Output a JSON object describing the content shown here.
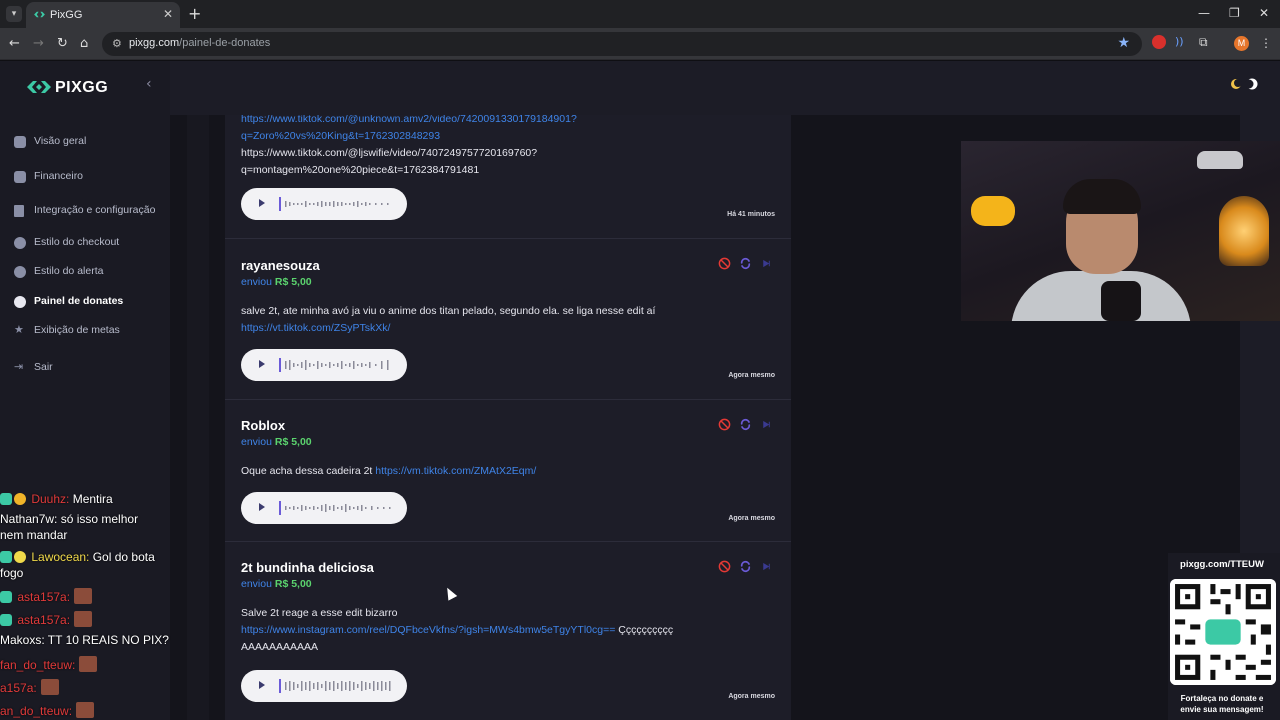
{
  "browser": {
    "tab_title": "PixGG",
    "url_host": "pixgg.com",
    "url_path": "/painel-de-donates",
    "profile_initial": "M"
  },
  "app": {
    "logo": "PIXGG",
    "sidebar": {
      "items": [
        {
          "label": "Visão geral",
          "icon": "home-icon"
        },
        {
          "label": "Financeiro",
          "icon": "wallet-icon"
        },
        {
          "label": "Integração e configuração",
          "icon": "settings-icon"
        },
        {
          "label": "Estilo do checkout",
          "icon": "palette-icon"
        },
        {
          "label": "Estilo do alerta",
          "icon": "bell-icon"
        },
        {
          "label": "Painel de donates",
          "icon": "donate-icon",
          "active": true
        },
        {
          "label": "Exibição de metas",
          "icon": "star-icon"
        },
        {
          "label": "Sair",
          "icon": "logout-icon"
        }
      ]
    },
    "donations": [
      {
        "msg_lines": [
          "https://www.tiktok.com/@unknown.amv2/video/7420091330179184901?",
          "q=Zoro%20vs%20King&t=1762302848293"
        ],
        "msg_lines2": [
          "https://www.tiktok.com/@ljswifie/video/7407249757720169760?",
          "q=montagem%20one%20piece&t=1762384791481"
        ],
        "time": "Há 41 minutos"
      },
      {
        "name": "rayanesouza",
        "sent_label": "enviou",
        "amount": "R$ 5,00",
        "text": "salve 2t, ate minha avó ja viu o anime dos titan pelado, segundo ela. se liga nesse edit aí",
        "link": "https://vt.tiktok.com/ZSyPTskXk/",
        "time": "Agora mesmo"
      },
      {
        "name": "Roblox",
        "sent_label": "enviou",
        "amount": "R$ 5,00",
        "text": "Oque acha dessa cadeira 2t ",
        "link": "https://vm.tiktok.com/ZMAtX2Eqm/",
        "time": "Agora mesmo"
      },
      {
        "name": "2t bundinha deliciosa",
        "sent_label": "enviou",
        "amount": "R$ 5,00",
        "text": "Salve 2t reage a esse edit bizarro",
        "link": "https://www.instagram.com/reel/DQFbceVkfns/?igsh=MWs4bmw5eTgyYTl0cg==",
        "text_after": " Çççççççççç",
        "text_line3": "AAAAAAAAAAA",
        "time": "Agora mesmo"
      }
    ]
  },
  "chat": [
    {
      "user": "Duuhz:",
      "color": "#e03a3a",
      "text": " Mentira"
    },
    {
      "user": "Nathan7w:",
      "color": "#ffffff",
      "text": " só isso melhor"
    },
    {
      "user": "",
      "color": "#ffffff",
      "text": "nem mandar"
    },
    {
      "user": "Lawocean:",
      "color": "#f0d94a",
      "text": " Gol do bota"
    },
    {
      "user": "",
      "color": "#ffffff",
      "text": "fogo"
    },
    {
      "user": "asta157a:",
      "color": "#e03a3a",
      "text": ""
    },
    {
      "user": "asta157a:",
      "color": "#e03a3a",
      "text": ""
    },
    {
      "user": "Makoxs:",
      "color": "#ffffff",
      "text": " TT 10 REAIS NO PIX?"
    },
    {
      "user": "fan_do_tteuw:",
      "color": "#e03a3a",
      "text": ""
    },
    {
      "user": "a157a:",
      "color": "#e03a3a",
      "text": ""
    },
    {
      "user": "an_do_tteuw:",
      "color": "#e03a3a",
      "text": ""
    }
  ],
  "qr_panel": {
    "title": "pixgg.com/TTEUW",
    "caption_line1": "Fortaleça no donate e",
    "caption_line2": "envie sua mensagem!"
  },
  "colors": {
    "accent_blue": "#3f84e8",
    "money_green": "#5bd36e",
    "logo_green": "#3cc9a5",
    "ban_red": "#e53935",
    "replay_purple": "#6b5bd8"
  }
}
